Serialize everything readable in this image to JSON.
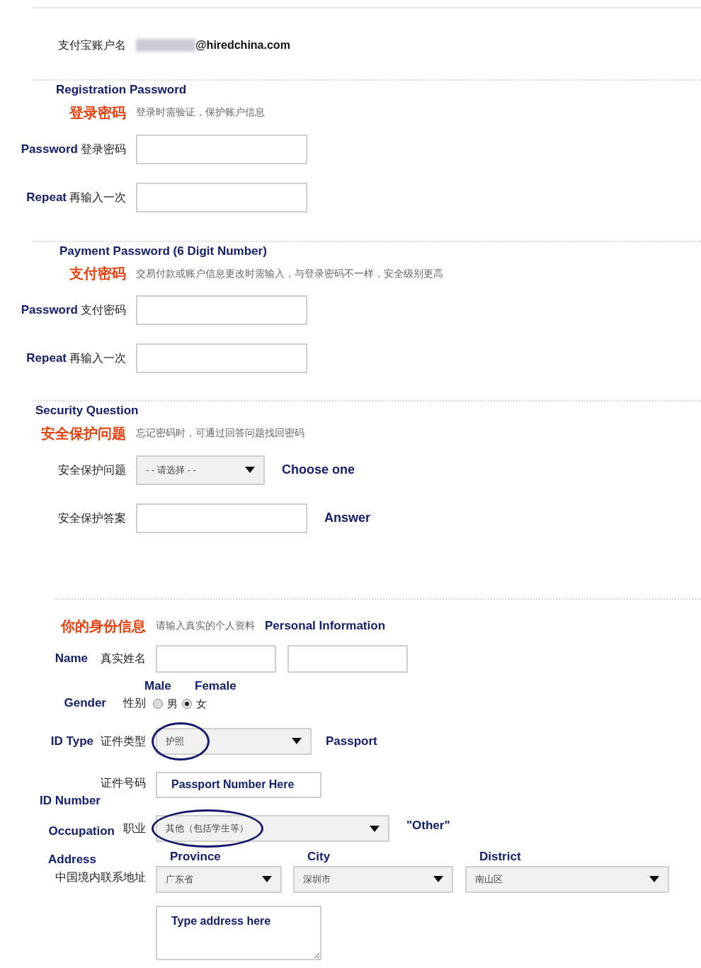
{
  "account": {
    "label": "支付宝账户名",
    "value": "@hiredchina.com"
  },
  "sections": [
    {
      "annotation": "Registration Password",
      "title": "登录密码",
      "hint": "登录时需验证，保护账户信息",
      "fields": [
        {
          "kind": "text",
          "label_en": "Password",
          "label": "登录密码"
        },
        {
          "kind": "text",
          "label_en": "Repeat",
          "label": "再输入一次"
        }
      ]
    },
    {
      "annotation": "Payment Password (6 Digit Number)",
      "title": "支付密码",
      "hint": "交易付款或账户信息更改时需输入，与登录密码不一样，安全级别更高",
      "fields": [
        {
          "kind": "text",
          "label_en": "Password",
          "label": "支付密码"
        },
        {
          "kind": "text",
          "label_en": "Repeat",
          "label": "再输入一次"
        }
      ]
    },
    {
      "annotation": "Security Question",
      "title": "安全保护问题",
      "hint": "忘记密码时，可通过回答问题找回密码",
      "fields": [
        {
          "kind": "select",
          "label": "安全保护问题",
          "value": "- - 请选择 - -",
          "annotation": "Choose one"
        },
        {
          "kind": "text",
          "label": "安全保护答案",
          "annotation": "Answer"
        }
      ]
    }
  ],
  "personal": {
    "title": "你的身份信息",
    "hint": "请输入真实的个人资料",
    "annotation": "Personal Information",
    "name": {
      "label_en": "Name",
      "label": "真实姓名"
    },
    "gender": {
      "label_en": "Gender",
      "label": "性别",
      "options": [
        {
          "annotation": "Male",
          "label": "男",
          "selected": false
        },
        {
          "annotation": "Female",
          "label": "女",
          "selected": true
        }
      ]
    },
    "id_type": {
      "label_en": "ID Type",
      "label": "证件类型",
      "value": "护照",
      "circled": true,
      "annotation": "Passport"
    },
    "id_number": {
      "label": "证件号码",
      "label_en": "ID Number",
      "placeholder": "Passport Number Here"
    },
    "occupation": {
      "label_en": "Occupation",
      "label": "职业",
      "value": "其他（包括学生等）",
      "circled": true,
      "annotation": "\"Other\""
    },
    "address": {
      "label_en": "Address",
      "label": "中国境内联系地址",
      "selects": [
        {
          "annotation": "Province",
          "value": "广东省"
        },
        {
          "annotation": "City",
          "value": "深圳市"
        },
        {
          "annotation": "District",
          "value": "南山区"
        }
      ],
      "placeholder": "Type address here"
    }
  }
}
